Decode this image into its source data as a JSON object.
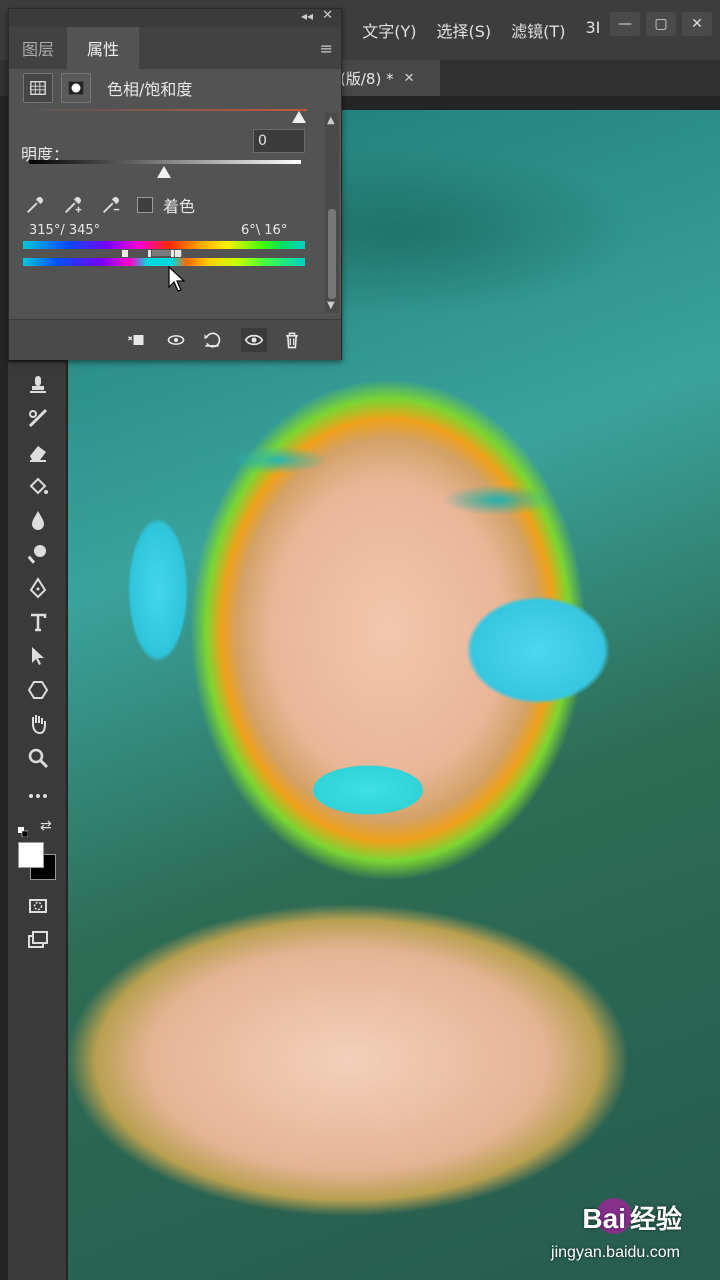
{
  "menu": {
    "items": [
      ")",
      "文字(Y)",
      "选择(S)",
      "滤镜(T)",
      "3I"
    ]
  },
  "window_controls": {
    "minimize": "—",
    "restore": "▢",
    "close": "✕"
  },
  "doc_tab": {
    "label": "(版/8) *",
    "close": "✕"
  },
  "panel": {
    "tabs": {
      "layers": "图层",
      "properties": "属性"
    },
    "title": "色相/饱和度",
    "lightness_label": "明度：",
    "lightness_value": "0",
    "colorize_label": "着色",
    "range_left": "315°/ 345°",
    "range_right": "6°\\ 16°"
  },
  "watermark": {
    "brand": "Bai",
    "brand_cn": "经验",
    "url": "jingyan.baidu.com"
  },
  "colors": {
    "accent": "#535353",
    "canvas_bg": "#252525"
  }
}
